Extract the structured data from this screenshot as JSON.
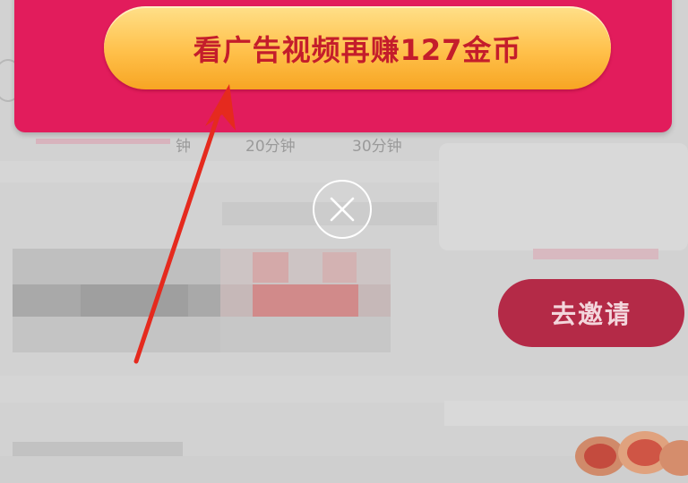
{
  "popup": {
    "ad_button_label": "看广告视频再赚127金币"
  },
  "background": {
    "timeline_ticks": [
      "钟",
      "20分钟",
      "30分钟"
    ],
    "invite_button_label": "去邀请"
  },
  "icons": {
    "close": "close-circle-icon",
    "arrow": "red-arrow-annotation"
  },
  "colors": {
    "popup_bg": "#e21c5c",
    "ad_button_text": "#c41d2b",
    "ad_button_gold": "#ffc04a",
    "invite_button_bg": "#b42a47"
  }
}
